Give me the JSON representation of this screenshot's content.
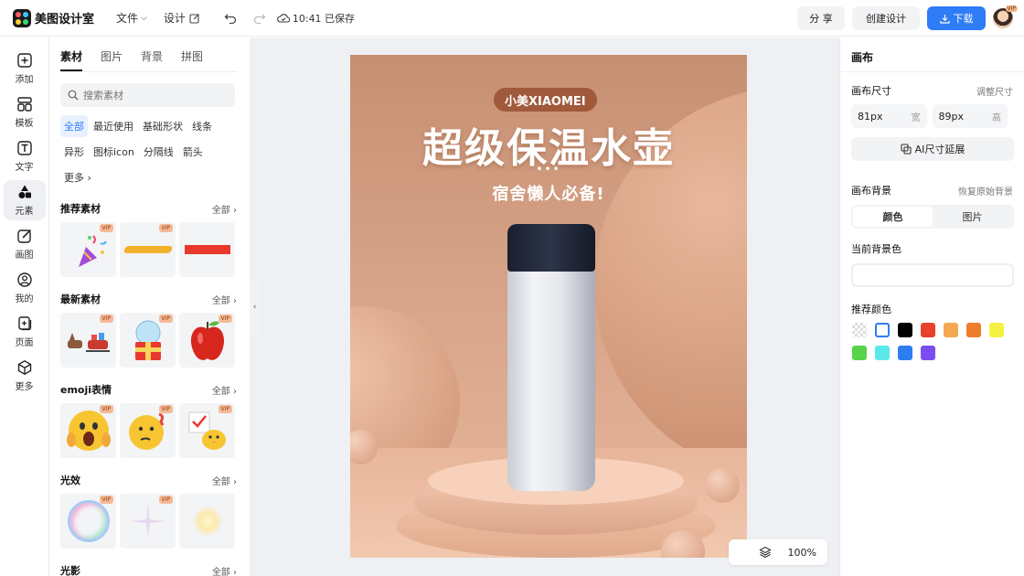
{
  "topbar": {
    "app_name": "美图设计室",
    "menu_file": "文件",
    "menu_design": "设计",
    "saved_status": "10:41 已保存",
    "share_label": "分 享",
    "create_label": "创建设计",
    "download_label": "下载",
    "avatar_badge": "VIP"
  },
  "rail": {
    "items": [
      {
        "label": "添加"
      },
      {
        "label": "模板"
      },
      {
        "label": "文字"
      },
      {
        "label": "元素"
      },
      {
        "label": "画图"
      },
      {
        "label": "我的"
      },
      {
        "label": "页面"
      },
      {
        "label": "更多"
      }
    ]
  },
  "panel": {
    "tabs": [
      "素材",
      "图片",
      "背景",
      "拼图"
    ],
    "search_placeholder": "搜索素材",
    "chips": [
      "全部",
      "最近使用",
      "基础形状",
      "线条",
      "异形",
      "图标icon",
      "分隔线",
      "箭头",
      "更多"
    ],
    "sections": [
      {
        "title": "推荐素材",
        "all": "全部"
      },
      {
        "title": "最新素材",
        "all": "全部"
      },
      {
        "title": "emoji表情",
        "all": "全部"
      },
      {
        "title": "光效",
        "all": "全部"
      },
      {
        "title": "光影",
        "all": "全部"
      }
    ],
    "vip_tag": "VIP"
  },
  "poster": {
    "badge": "小美XIAOMEI",
    "title": "超级保温水壶",
    "dots": "•••",
    "subtitle": "宿舍懒人必备!"
  },
  "zoom": {
    "level": "100%"
  },
  "right": {
    "title": "画布",
    "size_label": "画布尺寸",
    "adjust_link": "调整尺寸",
    "width_value": "81px",
    "width_unit": "宽",
    "height_value": "89px",
    "height_unit": "高",
    "ai_button": "AI尺寸延展",
    "bg_label": "画布背景",
    "restore_link": "恢复原始背景",
    "seg_color": "颜色",
    "seg_image": "图片",
    "current_bg_label": "当前背景色",
    "recommend_label": "推荐颜色",
    "swatches": [
      "transparent",
      "#ffffff",
      "#000000",
      "#e8412c",
      "#f3a851",
      "#ef7c2c",
      "#f5f142",
      "#58d34a",
      "#5be8e8",
      "#2c7ef0",
      "#7b4cf0"
    ]
  },
  "colors": {
    "accent": "#2e7cf6",
    "poster_bg": "#d6a388"
  }
}
